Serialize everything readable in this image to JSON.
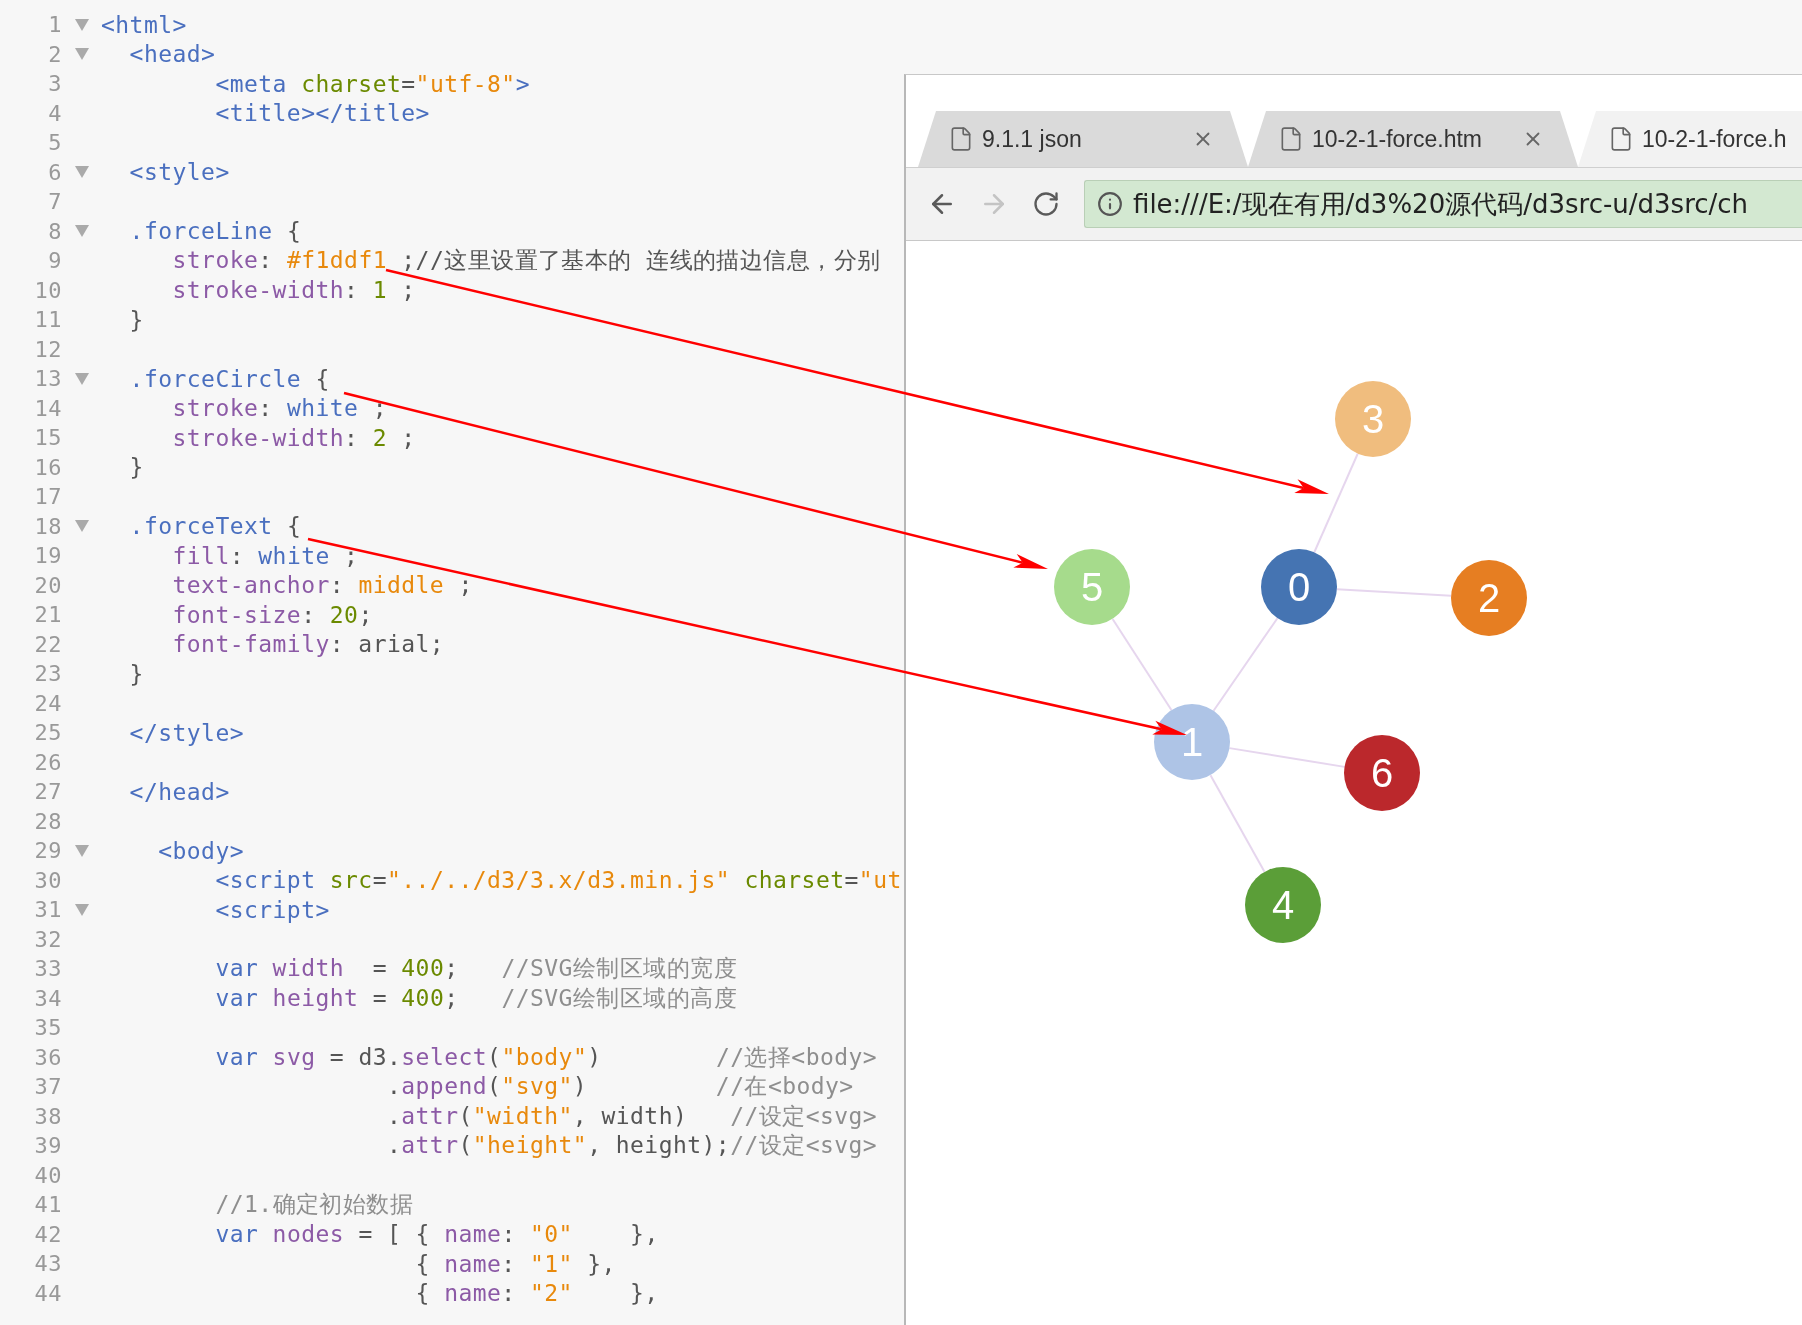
{
  "editor": {
    "lines": [
      {
        "number": "1",
        "foldable": true,
        "tokens": [
          {
            "kind": "tag",
            "text": "<html>"
          }
        ]
      },
      {
        "number": "2",
        "foldable": true,
        "tokens": [
          {
            "kind": "tag",
            "text": "  <head>"
          }
        ]
      },
      {
        "number": "3",
        "foldable": false,
        "tokens": [
          {
            "kind": "tag",
            "text": "        <meta "
          },
          {
            "kind": "attr",
            "text": "charset"
          },
          {
            "kind": "plain",
            "text": "="
          },
          {
            "kind": "string",
            "text": "\"utf-8\""
          },
          {
            "kind": "tag",
            "text": ">"
          }
        ]
      },
      {
        "number": "4",
        "foldable": false,
        "tokens": [
          {
            "kind": "tag",
            "text": "        <title></title>"
          }
        ]
      },
      {
        "number": "5",
        "foldable": false
      },
      {
        "number": "6",
        "foldable": true,
        "tokens": [
          {
            "kind": "tag",
            "text": "  <style>"
          }
        ]
      },
      {
        "number": "7",
        "foldable": false
      },
      {
        "number": "8",
        "foldable": true,
        "tokens": [
          {
            "kind": "selector",
            "text": "  .forceLine"
          },
          {
            "kind": "plain",
            "text": " {"
          }
        ]
      },
      {
        "number": "9",
        "foldable": false,
        "tokens": [
          {
            "kind": "property",
            "text": "     stroke"
          },
          {
            "kind": "plain",
            "text": ": "
          },
          {
            "kind": "string",
            "text": "#f1ddf1"
          },
          {
            "kind": "plain",
            "text": " ;//这里设置了基本的 连线的描边信息，分别"
          }
        ]
      },
      {
        "number": "10",
        "foldable": false,
        "tokens": [
          {
            "kind": "property",
            "text": "     stroke-width"
          },
          {
            "kind": "plain",
            "text": ": "
          },
          {
            "kind": "number",
            "text": "1"
          },
          {
            "kind": "plain",
            "text": " ;"
          }
        ]
      },
      {
        "number": "11",
        "foldable": false,
        "tokens": [
          {
            "kind": "plain",
            "text": "  }"
          }
        ]
      },
      {
        "number": "12",
        "foldable": false
      },
      {
        "number": "13",
        "foldable": true,
        "tokens": [
          {
            "kind": "selector",
            "text": "  .forceCircle"
          },
          {
            "kind": "plain",
            "text": " {"
          }
        ]
      },
      {
        "number": "14",
        "foldable": false,
        "tokens": [
          {
            "kind": "property",
            "text": "     stroke"
          },
          {
            "kind": "plain",
            "text": ": "
          },
          {
            "kind": "value",
            "text": "white"
          },
          {
            "kind": "plain",
            "text": " ;"
          }
        ]
      },
      {
        "number": "15",
        "foldable": false,
        "tokens": [
          {
            "kind": "property",
            "text": "     stroke-width"
          },
          {
            "kind": "plain",
            "text": ": "
          },
          {
            "kind": "number",
            "text": "2"
          },
          {
            "kind": "plain",
            "text": " ;"
          }
        ]
      },
      {
        "number": "16",
        "foldable": false,
        "tokens": [
          {
            "kind": "plain",
            "text": "  }"
          }
        ]
      },
      {
        "number": "17",
        "foldable": false
      },
      {
        "number": "18",
        "foldable": true,
        "tokens": [
          {
            "kind": "selector",
            "text": "  .forceText"
          },
          {
            "kind": "plain",
            "text": " {"
          }
        ]
      },
      {
        "number": "19",
        "foldable": false,
        "tokens": [
          {
            "kind": "property",
            "text": "     fill"
          },
          {
            "kind": "plain",
            "text": ": "
          },
          {
            "kind": "value",
            "text": "white"
          },
          {
            "kind": "plain",
            "text": " ;"
          }
        ]
      },
      {
        "number": "20",
        "foldable": false,
        "tokens": [
          {
            "kind": "property",
            "text": "     text-anchor"
          },
          {
            "kind": "plain",
            "text": ": "
          },
          {
            "kind": "string",
            "text": "middle"
          },
          {
            "kind": "plain",
            "text": " ;"
          }
        ]
      },
      {
        "number": "21",
        "foldable": false,
        "tokens": [
          {
            "kind": "property",
            "text": "     font-size"
          },
          {
            "kind": "plain",
            "text": ": "
          },
          {
            "kind": "number",
            "text": "20"
          },
          {
            "kind": "plain",
            "text": ";"
          }
        ]
      },
      {
        "number": "22",
        "foldable": false,
        "tokens": [
          {
            "kind": "property",
            "text": "     font-family"
          },
          {
            "kind": "plain",
            "text": ": arial;"
          }
        ]
      },
      {
        "number": "23",
        "foldable": false,
        "tokens": [
          {
            "kind": "plain",
            "text": "  }"
          }
        ]
      },
      {
        "number": "24",
        "foldable": false
      },
      {
        "number": "25",
        "foldable": false,
        "tokens": [
          {
            "kind": "tag",
            "text": "  </style>"
          }
        ]
      },
      {
        "number": "26",
        "foldable": false
      },
      {
        "number": "27",
        "foldable": false,
        "tokens": [
          {
            "kind": "tag",
            "text": "  </head>"
          }
        ]
      },
      {
        "number": "28",
        "foldable": false
      },
      {
        "number": "29",
        "foldable": true,
        "tokens": [
          {
            "kind": "tag",
            "text": "    <body>"
          }
        ]
      },
      {
        "number": "30",
        "foldable": false,
        "tokens": [
          {
            "kind": "tag",
            "text": "        <script "
          },
          {
            "kind": "attr",
            "text": "src"
          },
          {
            "kind": "plain",
            "text": "="
          },
          {
            "kind": "string",
            "text": "\"../../d3/3.x/d3.min.js\""
          },
          {
            "kind": "attr",
            "text": " charset"
          },
          {
            "kind": "plain",
            "text": "="
          },
          {
            "kind": "string",
            "text": "\"ut"
          }
        ]
      },
      {
        "number": "31",
        "foldable": true,
        "tokens": [
          {
            "kind": "tag",
            "text": "        <script>"
          }
        ]
      },
      {
        "number": "32",
        "foldable": false
      },
      {
        "number": "33",
        "foldable": false,
        "tokens": [
          {
            "kind": "keyword",
            "text": "        var "
          },
          {
            "kind": "property",
            "text": "width"
          },
          {
            "kind": "plain",
            "text": "  = "
          },
          {
            "kind": "number",
            "text": "400"
          },
          {
            "kind": "plain",
            "text": ";   "
          },
          {
            "kind": "comment",
            "text": "//SVG绘制区域的宽度"
          }
        ]
      },
      {
        "number": "34",
        "foldable": false,
        "tokens": [
          {
            "kind": "keyword",
            "text": "        var "
          },
          {
            "kind": "property",
            "text": "height"
          },
          {
            "kind": "plain",
            "text": " = "
          },
          {
            "kind": "number",
            "text": "400"
          },
          {
            "kind": "plain",
            "text": ";   "
          },
          {
            "kind": "comment",
            "text": "//SVG绘制区域的高度"
          }
        ]
      },
      {
        "number": "35",
        "foldable": false
      },
      {
        "number": "36",
        "foldable": false,
        "tokens": [
          {
            "kind": "keyword",
            "text": "        var "
          },
          {
            "kind": "property",
            "text": "svg"
          },
          {
            "kind": "plain",
            "text": " = d3."
          },
          {
            "kind": "property",
            "text": "select"
          },
          {
            "kind": "plain",
            "text": "("
          },
          {
            "kind": "string",
            "text": "\"body\""
          },
          {
            "kind": "plain",
            "text": ")        "
          },
          {
            "kind": "comment",
            "text": "//选择<body>"
          }
        ]
      },
      {
        "number": "37",
        "foldable": false,
        "tokens": [
          {
            "kind": "plain",
            "text": "                    ."
          },
          {
            "kind": "property",
            "text": "append"
          },
          {
            "kind": "plain",
            "text": "("
          },
          {
            "kind": "string",
            "text": "\"svg\""
          },
          {
            "kind": "plain",
            "text": ")         "
          },
          {
            "kind": "comment",
            "text": "//在<body>"
          }
        ]
      },
      {
        "number": "38",
        "foldable": false,
        "tokens": [
          {
            "kind": "plain",
            "text": "                    ."
          },
          {
            "kind": "property",
            "text": "attr"
          },
          {
            "kind": "plain",
            "text": "("
          },
          {
            "kind": "string",
            "text": "\"width\""
          },
          {
            "kind": "plain",
            "text": ", width)   "
          },
          {
            "kind": "comment",
            "text": "//设定<svg>"
          }
        ]
      },
      {
        "number": "39",
        "foldable": false,
        "tokens": [
          {
            "kind": "plain",
            "text": "                    ."
          },
          {
            "kind": "property",
            "text": "attr"
          },
          {
            "kind": "plain",
            "text": "("
          },
          {
            "kind": "string",
            "text": "\"height\""
          },
          {
            "kind": "plain",
            "text": ", height);"
          },
          {
            "kind": "comment",
            "text": "//设定<svg>"
          }
        ]
      },
      {
        "number": "40",
        "foldable": false
      },
      {
        "number": "41",
        "foldable": false,
        "tokens": [
          {
            "kind": "comment",
            "text": "        //1.确定初始数据"
          }
        ]
      },
      {
        "number": "42",
        "foldable": false,
        "tokens": [
          {
            "kind": "keyword",
            "text": "        var "
          },
          {
            "kind": "property",
            "text": "nodes"
          },
          {
            "kind": "plain",
            "text": " = [ { "
          },
          {
            "kind": "property",
            "text": "name"
          },
          {
            "kind": "plain",
            "text": ": "
          },
          {
            "kind": "string",
            "text": "\"0\""
          },
          {
            "kind": "plain",
            "text": "    },"
          }
        ]
      },
      {
        "number": "43",
        "foldable": false,
        "tokens": [
          {
            "kind": "plain",
            "text": "                      { "
          },
          {
            "kind": "property",
            "text": "name"
          },
          {
            "kind": "plain",
            "text": ": "
          },
          {
            "kind": "string",
            "text": "\"1\""
          },
          {
            "kind": "plain",
            "text": " },"
          }
        ]
      },
      {
        "number": "44",
        "foldable": false,
        "tokens": [
          {
            "kind": "plain",
            "text": "                      { "
          },
          {
            "kind": "property",
            "text": "name"
          },
          {
            "kind": "plain",
            "text": ": "
          },
          {
            "kind": "string",
            "text": "\"2\""
          },
          {
            "kind": "plain",
            "text": "    },"
          }
        ]
      }
    ]
  },
  "browser": {
    "tabs": [
      {
        "title": "9.1.1 json",
        "selected": false,
        "closable": true
      },
      {
        "title": "10-2-1-force.htm",
        "selected": false,
        "closable": true
      },
      {
        "title": "10-2-1-force.h",
        "selected": true,
        "closable": false
      }
    ],
    "navigation": [
      {
        "kind": "back",
        "disabled": false
      },
      {
        "kind": "forward",
        "disabled": true
      },
      {
        "kind": "reload",
        "disabled": false
      }
    ],
    "address": "file:///E:/现在有用/d3%20源代码/d3src-u/d3src/ch",
    "graph": {
      "nodes": [
        {
          "label": "0",
          "color": "#4574b2"
        },
        {
          "label": "1",
          "color": "#aec4e6"
        },
        {
          "label": "2",
          "color": "#e67e22"
        },
        {
          "label": "3",
          "color": "#f0bd7e"
        },
        {
          "label": "4",
          "color": "#5b9e38"
        },
        {
          "label": "5",
          "color": "#a6db8c"
        },
        {
          "label": "6",
          "color": "#bb282c"
        }
      ]
    }
  }
}
